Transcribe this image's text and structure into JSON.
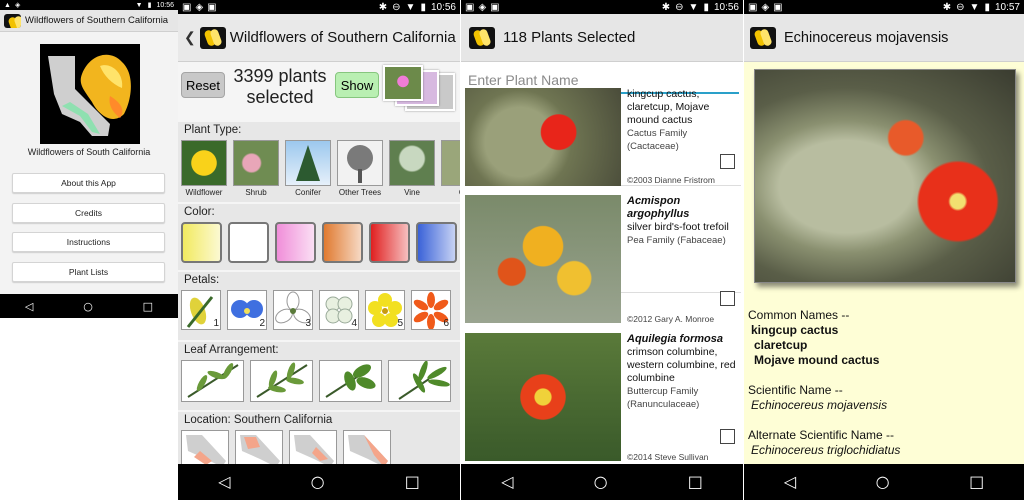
{
  "status": [
    {
      "time": "10:56"
    },
    {
      "time": "10:56"
    },
    {
      "time": "10:56"
    },
    {
      "time": "10:57"
    }
  ],
  "nav": {
    "back": "◁",
    "home": "○",
    "recents": "□"
  },
  "screen1": {
    "title": "Wildflowers of Southern California",
    "caption": "Wildflowers of South California",
    "buttons": [
      "About this App",
      "Credits",
      "Instructions",
      "Plant Lists"
    ]
  },
  "screen2": {
    "title": "Wildflowers of Southern California",
    "reset_label": "Reset",
    "count_line1": "3399 plants",
    "count_line2": "selected",
    "show_label": "Show",
    "sections": {
      "plant_type": "Plant Type:",
      "color": "Color:",
      "petals": "Petals:",
      "leaf": "Leaf Arrangement:",
      "location": "Location: Southern California"
    },
    "plant_types": [
      "Wildflower",
      "Shrub",
      "Conifer",
      "Other Trees",
      "Vine",
      "Ca"
    ],
    "colors": [
      "#f2ea60",
      "#ffffff",
      "#f08ed9",
      "#e07a30",
      "#e02020",
      "#3a62d8"
    ],
    "petal_counts": [
      "1",
      "2",
      "3",
      "4",
      "5",
      "6"
    ]
  },
  "screen3": {
    "title": "118 Plants Selected",
    "search_placeholder": "Enter Plant Name",
    "plants": [
      {
        "scientific": "",
        "common": "kingcup cactus, claretcup, Mojave mound cactus",
        "family": "Cactus Family (Cactaceae)",
        "copyright": "©2003 Dianne Fristrom"
      },
      {
        "scientific": "Acmispon argophyllus",
        "common": "silver bird's-foot trefoil",
        "family": "Pea Family (Fabaceae)",
        "copyright": "©2012 Gary A. Monroe"
      },
      {
        "scientific": "Aquilegia formosa",
        "common": "crimson columbine, western columbine, red columbine",
        "family": "Buttercup Family (Ranunculaceae)",
        "copyright": "©2014 Steve Sullivan"
      }
    ]
  },
  "screen4": {
    "title": "Echinocereus mojavensis",
    "common_heading": "Common Names --",
    "common_names": [
      "kingcup cactus",
      "claretcup",
      "Mojave mound cactus"
    ],
    "scientific_heading": "Scientific Name --",
    "scientific_name": "Echinocereus mojavensis",
    "alt_heading": "Alternate Scientific Name --",
    "alt_name": "Echinocereus triglochidiatus"
  }
}
